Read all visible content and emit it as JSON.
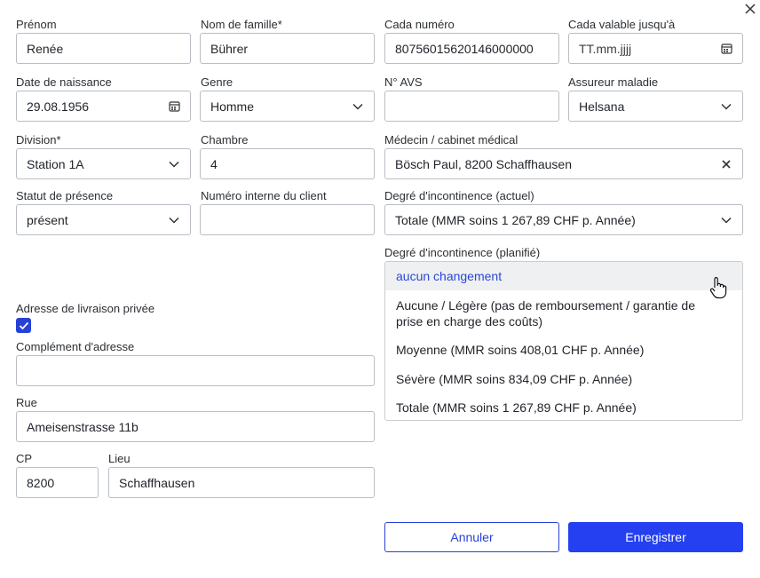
{
  "form": {
    "prenom": {
      "label": "Prénom",
      "value": "Renée"
    },
    "nom": {
      "label": "Nom de famille*",
      "value": "Bührer"
    },
    "cada_numero": {
      "label": "Cada numéro",
      "value": "80756015620146000000"
    },
    "cada_valable": {
      "label": "Cada valable jusqu'à",
      "placeholder": "TT.mm.jjjj"
    },
    "date_naissance": {
      "label": "Date de naissance",
      "value": "29.08.1956"
    },
    "genre": {
      "label": "Genre",
      "value": "Homme"
    },
    "avs": {
      "label": "N° AVS",
      "value": ""
    },
    "assureur": {
      "label": "Assureur maladie",
      "value": "Helsana"
    },
    "division": {
      "label": "Division*",
      "value": "Station 1A"
    },
    "chambre": {
      "label": "Chambre",
      "value": "4"
    },
    "medecin": {
      "label": "Médecin / cabinet médical",
      "value": "Bösch Paul, 8200 Schaffhausen"
    },
    "statut": {
      "label": "Statut de présence",
      "value": "présent"
    },
    "numero_interne": {
      "label": "Numéro interne du client",
      "value": ""
    },
    "incontinence_actuel": {
      "label": "Degré d'incontinence (actuel)",
      "value": "Totale (MMR soins 1 267,89 CHF p. Année)"
    },
    "incontinence_planifie": {
      "label": "Degré d'incontinence (planifié)",
      "options": [
        "aucun changement",
        "Aucune / Légère (pas de remboursement / garantie de prise en charge des coûts)",
        "Moyenne (MMR soins 408,01 CHF p. Année)",
        "Sévère (MMR soins 834,09 CHF p. Année)",
        "Totale (MMR soins 1 267,89 CHF p. Année)"
      ],
      "highlighted_index": 0
    },
    "adresse_privee": {
      "label": "Adresse de livraison privée",
      "checked": true
    },
    "complement": {
      "label": "Complément d'adresse",
      "value": ""
    },
    "rue": {
      "label": "Rue",
      "value": "Ameisenstrasse 11b"
    },
    "cp": {
      "label": "CP",
      "value": "8200"
    },
    "lieu": {
      "label": "Lieu",
      "value": "Schaffhausen"
    }
  },
  "buttons": {
    "cancel": "Annuler",
    "save": "Enregistrer"
  },
  "colors": {
    "accent": "#2440f0",
    "highlight_text": "#2a48d6",
    "border": "#b9bec4"
  },
  "icons": {
    "close": "close-icon",
    "calendar": "calendar-icon",
    "chevron": "chevron-down-icon",
    "clear": "clear-icon",
    "cursor": "hand-pointer-icon",
    "check": "checkmark-icon"
  }
}
